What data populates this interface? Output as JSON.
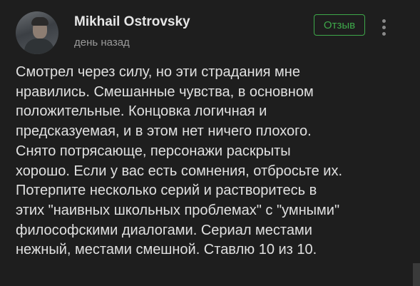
{
  "author": {
    "name": "Mikhail Ostrovsky",
    "posted": "день назад"
  },
  "badge": {
    "label": "Отзыв",
    "color": "#3ea84a"
  },
  "menu": {
    "icon": "kebab-menu-icon"
  },
  "review": {
    "lines": [
      "Смотрел через силу, но эти страдания мне",
      "нравились. Смешанные чувства, в основном",
      "положительные. Концовка логичная и",
      "предсказуемая, и в этом нет ничего плохого.",
      "Снято потрясающе, персонажи раскрыты",
      "хорошо. Если у вас есть сомнения, отбросьте их.",
      "Потерпите несколько серий и растворитесь в",
      "этих \"наивных школьных проблемах\" с \"умными\"",
      "философскими диалогами. Сериал местами",
      "нежный, местами смешной. Ставлю 10 из 10."
    ]
  },
  "colors": {
    "background": "#1e1e1e",
    "text": "#e0e0e0",
    "muted": "#9a9a9a"
  }
}
